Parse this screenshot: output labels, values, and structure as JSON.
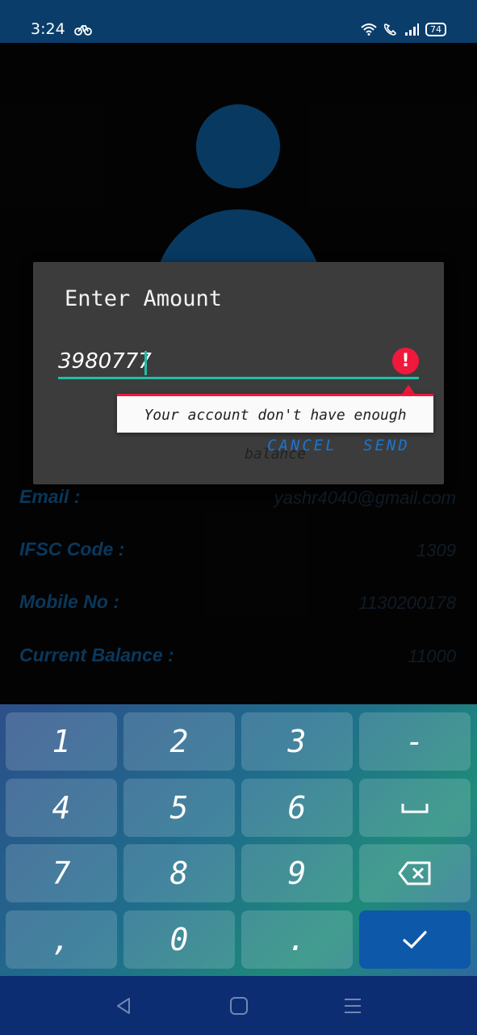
{
  "status_bar": {
    "time": "3:24",
    "battery": "74",
    "icons": [
      "bike-icon",
      "wifi-icon",
      "call-icon",
      "signal-icon",
      "battery-icon"
    ]
  },
  "profile": {
    "rows": [
      {
        "label": "Email :",
        "value": "yashr4040@gmail.com"
      },
      {
        "label": "IFSC Code :",
        "value": "1309"
      },
      {
        "label": "Mobile No :",
        "value": "1130200178"
      },
      {
        "label": "Current Balance :",
        "value": "11000"
      }
    ]
  },
  "dialog": {
    "title": "Enter Amount",
    "amount_value": "3980777",
    "error_message": "Your account don't have enough balance",
    "cancel_label": "CANCEL",
    "send_label": "SEND"
  },
  "keyboard": {
    "keys": [
      "1",
      "2",
      "3",
      "-",
      "4",
      "5",
      "6",
      "space",
      "7",
      "8",
      "9",
      "backspace",
      ",",
      "0",
      ".",
      "done"
    ]
  },
  "nav_bar": {
    "buttons": [
      "back-icon",
      "home-icon",
      "menu-icon"
    ]
  },
  "colors": {
    "accent": "#20bfa6",
    "error": "#f0183c",
    "primary": "#0b4d82",
    "button": "#1976d2"
  }
}
